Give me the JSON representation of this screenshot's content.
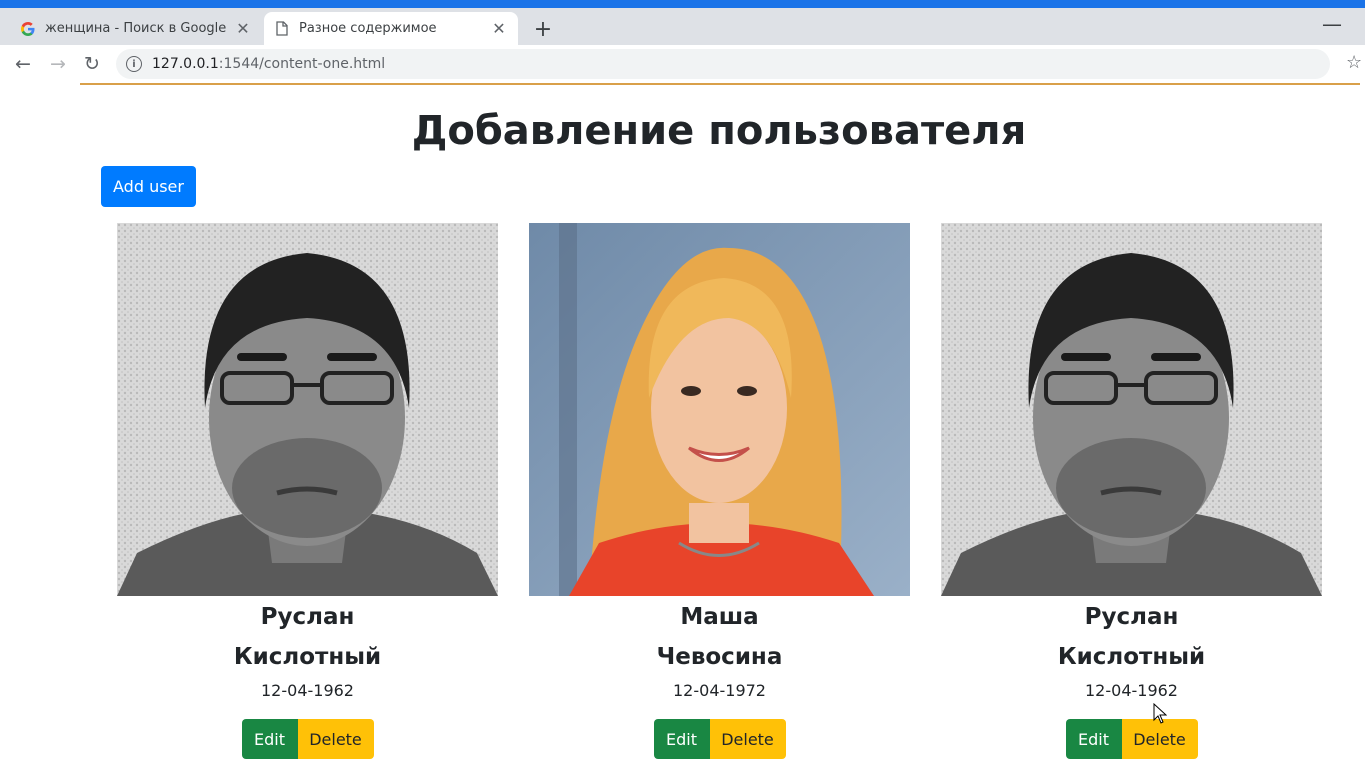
{
  "browser": {
    "tabs": [
      {
        "title": "женщина - Поиск в Google",
        "active": false,
        "favicon": "google-icon"
      },
      {
        "title": "Разное содержимое",
        "active": true,
        "favicon": "page-icon"
      }
    ],
    "new_tab_symbol": "+",
    "url_host": "127.0.0.1",
    "url_rest": ":1544/content-one.html",
    "accent_color": "#1a73e8"
  },
  "page": {
    "title": "Добавление пользователя",
    "add_button_label": "Add user",
    "edit_label": "Edit",
    "delete_label": "Delete",
    "colors": {
      "primary": "#007bff",
      "success": "#198743",
      "warning": "#ffc107"
    }
  },
  "users": [
    {
      "first_name": "Руслан",
      "last_name": "Кислотный",
      "birth_date": "12-04-1962"
    },
    {
      "first_name": "Маша",
      "last_name": "Чевосина",
      "birth_date": "12-04-1972"
    },
    {
      "first_name": "Руслан",
      "last_name": "Кислотный",
      "birth_date": "12-04-1962"
    }
  ]
}
